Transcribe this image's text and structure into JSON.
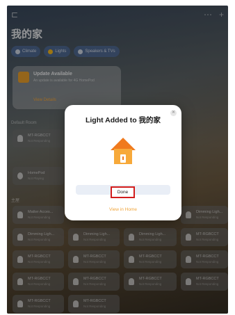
{
  "home": {
    "title": "我的家",
    "chips": [
      {
        "label": "Climate"
      },
      {
        "label": "Lights"
      },
      {
        "label": "Speakers & TVs"
      }
    ]
  },
  "update": {
    "title": "Update Available",
    "text": "An update is available for 4G HomePod",
    "link": "View Details"
  },
  "sections": {
    "top": "Default Room",
    "bottom": "主屋"
  },
  "tiles": [
    {
      "title": "MT-RGBCCT",
      "subtitle": "Not Responding"
    },
    {
      "title": "HomePod",
      "subtitle": "Not Playing"
    },
    {
      "title": "Matter Acces...",
      "subtitle": "Not Responding"
    },
    {
      "title": "Dimming Ligh...",
      "subtitle": "Not Responding"
    },
    {
      "title": "Dimming Ligh...",
      "subtitle": "Not Responding"
    },
    {
      "title": "Dimming Ligh...",
      "subtitle": "Not Responding"
    },
    {
      "title": "Dimming Ligh...",
      "subtitle": "Not Responding"
    },
    {
      "title": "MT-RGBCCT",
      "subtitle": "Not Responding"
    },
    {
      "title": "MT-RGBCCT",
      "subtitle": "Not Responding"
    },
    {
      "title": "MT-RGBCCT",
      "subtitle": "Not Responding"
    },
    {
      "title": "MT-RGBCCT",
      "subtitle": "Not Responding"
    },
    {
      "title": "MT-RGBCCT",
      "subtitle": "Not Responding"
    },
    {
      "title": "MT-RGBCCT",
      "subtitle": "Not Responding"
    },
    {
      "title": "MT-RGBCCT",
      "subtitle": "Not Responding"
    },
    {
      "title": "MT-RGBCCT",
      "subtitle": "Not Responding"
    },
    {
      "title": "MT-RGBCCT",
      "subtitle": "Not Responding"
    },
    {
      "title": "MT-RGBCCT",
      "subtitle": "Not Responding"
    },
    {
      "title": "MT-RGBCCT",
      "subtitle": "Not Responding"
    }
  ],
  "modal": {
    "title": "Light Added to 我的家",
    "close_icon": "close-icon",
    "done_label": "Done",
    "view_label": "View in Home"
  },
  "colors": {
    "accent": "#f0a43a",
    "house_roof": "#f07a1e",
    "house_body": "#f7a93a",
    "highlight": "#d21c1c"
  }
}
